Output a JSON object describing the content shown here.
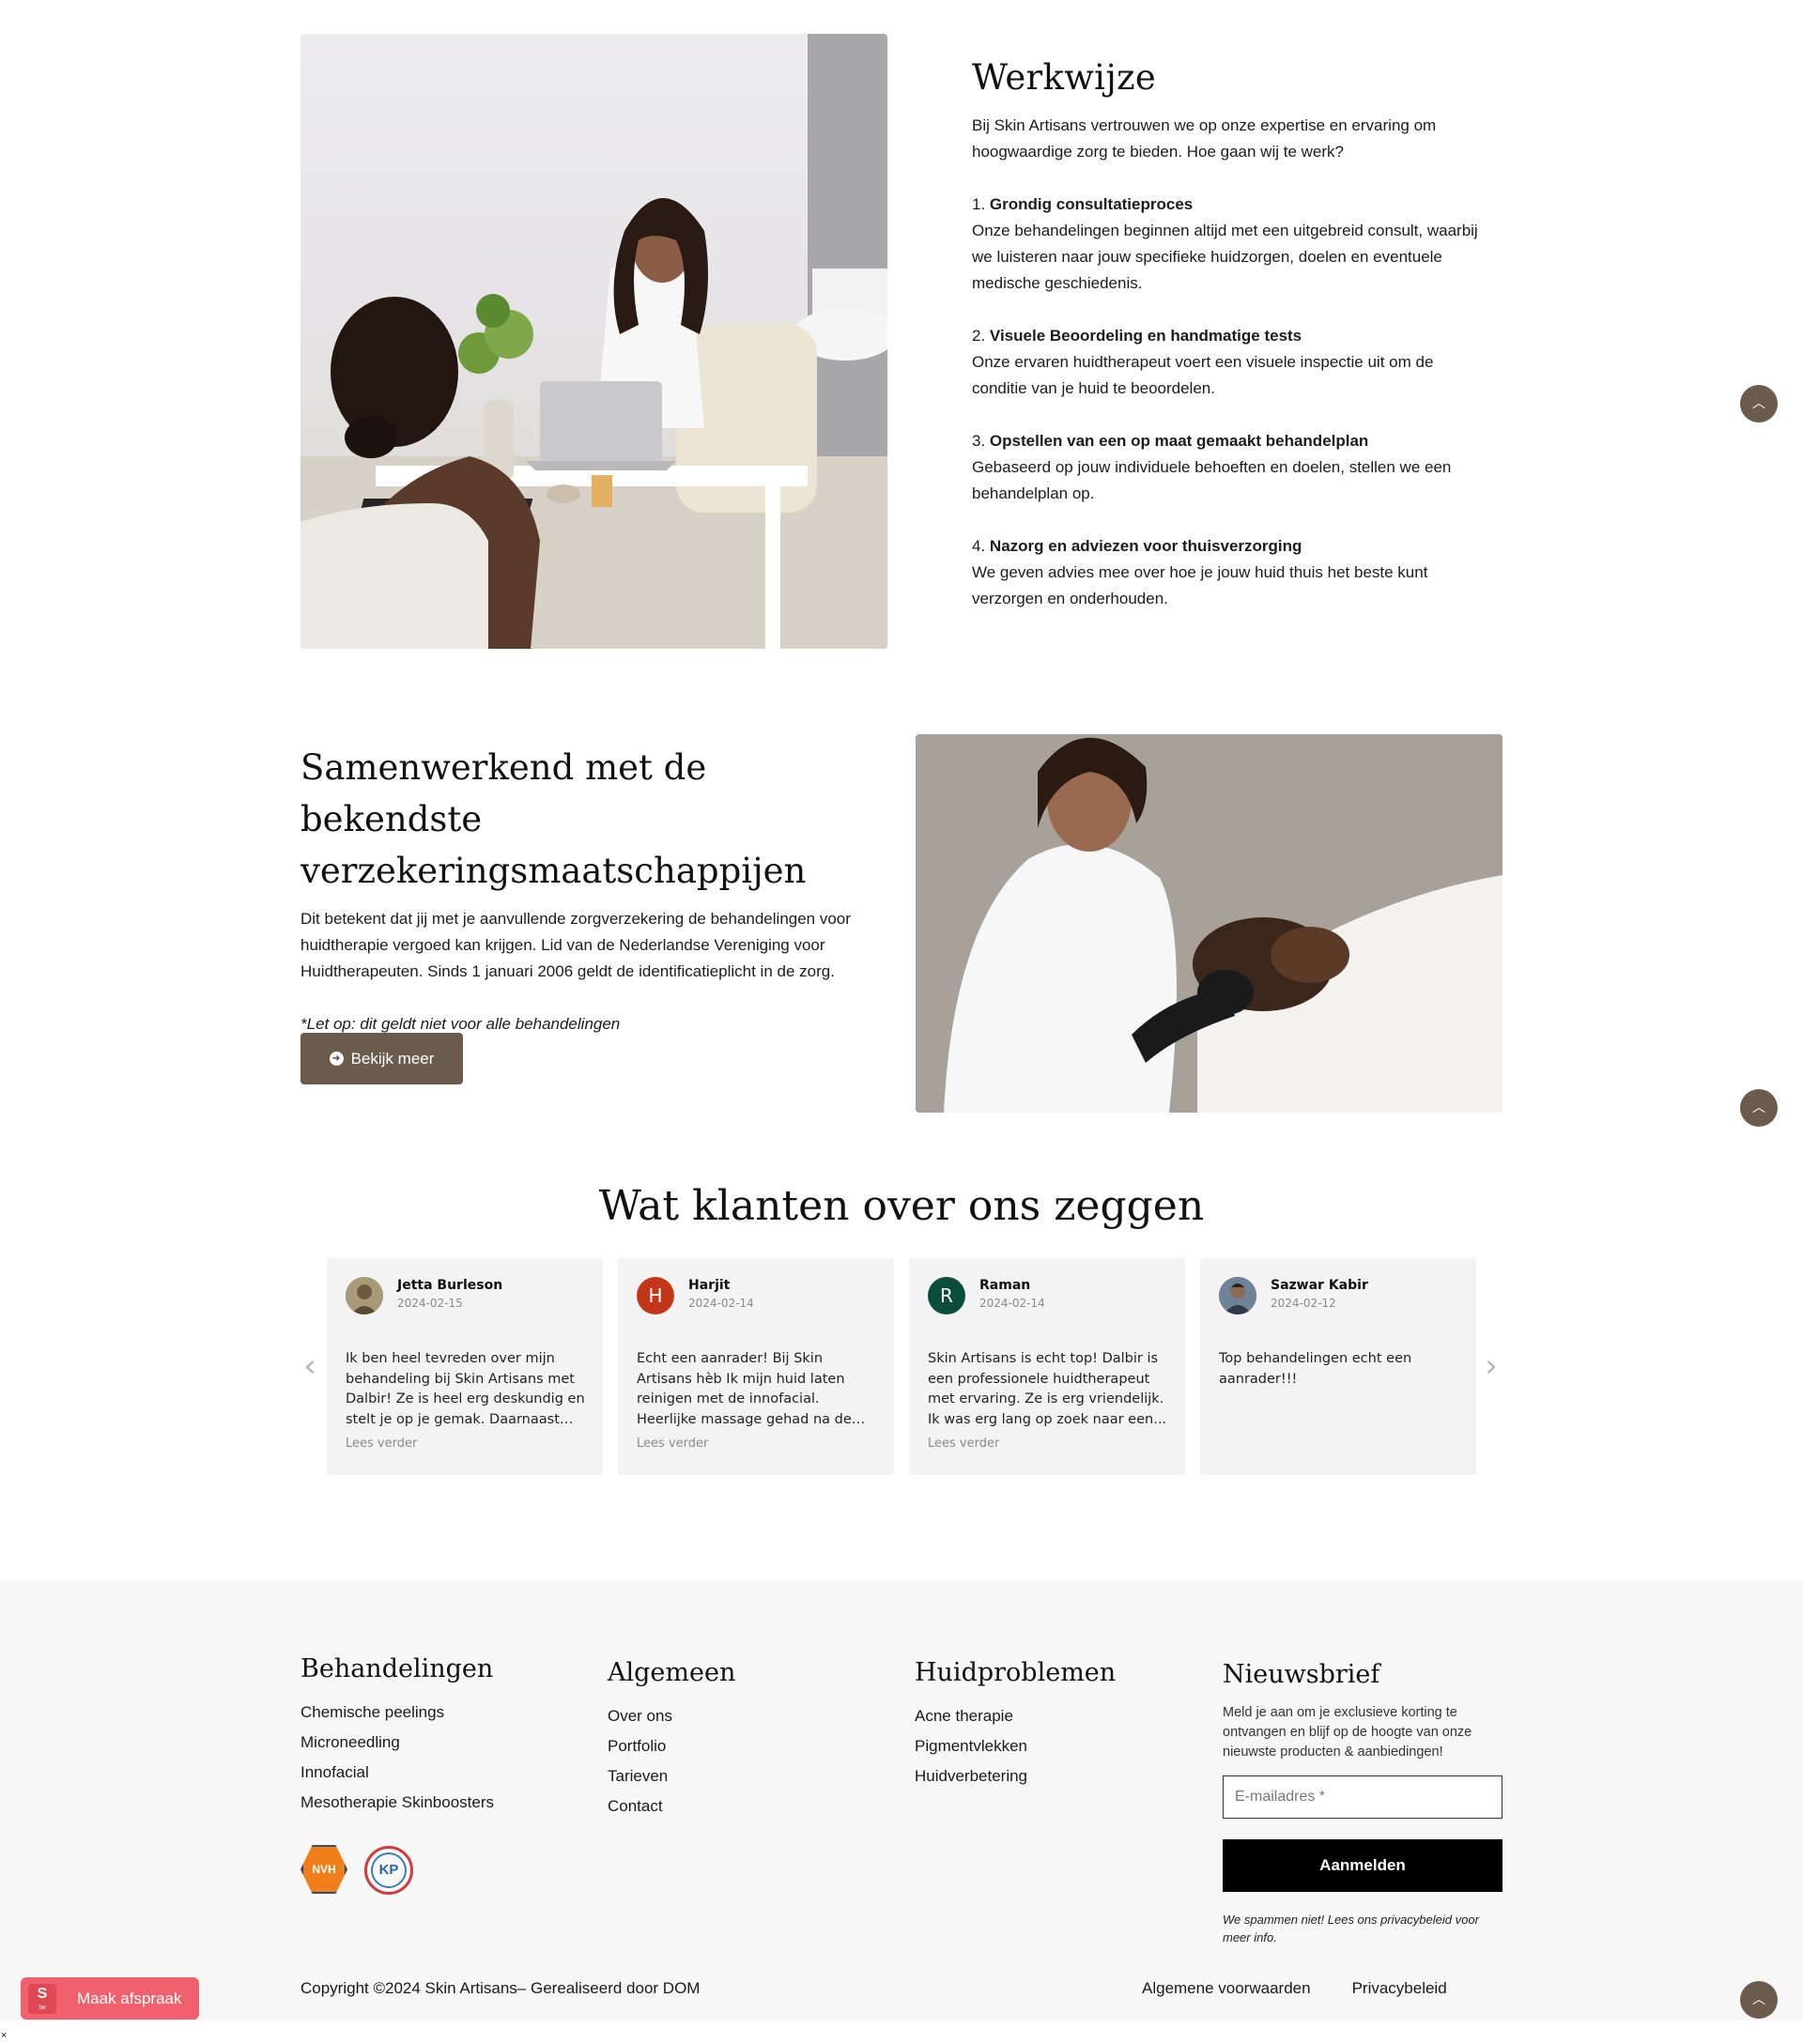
{
  "werkwijze": {
    "title": "Werkwijze",
    "intro": "Bij Skin Artisans vertrouwen we op onze expertise en ervaring om hoogwaardige zorg te bieden. Hoe gaan wij te werk?",
    "steps": [
      {
        "num": "1.",
        "title": "Grondig consultatieproces",
        "text": "Onze behandelingen beginnen altijd met een uitgebreid consult, waarbij we luisteren naar jouw specifieke huidzorgen, doelen en eventuele medische geschiedenis."
      },
      {
        "num": "2.",
        "title": "Visuele Beoordeling en handmatige tests",
        "text": "Onze ervaren huidtherapeut voert een visuele inspectie uit om de conditie van je huid te beoordelen."
      },
      {
        "num": "3.",
        "title": "Opstellen van een op maat gemaakt behandelplan",
        "text": "Gebaseerd op jouw individuele behoeften en doelen, stellen we een behandelplan op."
      },
      {
        "num": "4.",
        "title": "Nazorg en adviezen voor thuisverzorging",
        "text": "We geven advies mee over hoe je jouw huid thuis het beste kunt verzorgen en onderhouden."
      }
    ]
  },
  "samenwerkend": {
    "title": "Samenwerkend met de bekendste verzekeringsmaatschappijen",
    "text": "Dit betekent dat jij met je aanvullende zorgverzekering de behandelingen voor huidtherapie vergoed kan krijgen. Lid van de Nederlandse Vereniging voor Huidtherapeuten. Sinds 1 januari 2006 geldt de identificatieplicht in de zorg.",
    "note": "*Let op: dit geldt niet voor alle behandelingen",
    "button_label": "Bekijk meer"
  },
  "reviews": {
    "title": "Wat klanten over ons zeggen",
    "read_more": "Lees verder",
    "items": [
      {
        "name": "Jetta Burleson",
        "date": "2024-02-15",
        "initial": "",
        "avatar_color": "#8a7d62",
        "text": "Ik ben heel tevreden over mijn behandeling bij Skin Artisans met Dalbir! Ze is heel erg deskundig en stelt je op je gemak. Daarnaast be...",
        "has_more": true
      },
      {
        "name": "Harjit",
        "date": "2024-02-14",
        "initial": "H",
        "avatar_color": "#c2361a",
        "text": "Echt een aanrader! Bij Skin Artisans hèb Ik mijn huid laten reinigen met de innofacial. Heerlijke massage gehad na de behandeling. Niet...",
        "has_more": true
      },
      {
        "name": "Raman",
        "date": "2024-02-14",
        "initial": "R",
        "avatar_color": "#0b4d3b",
        "text": "Skin Artisans is echt top! Dalbir is een professionele huidtherapeut met ervaring. Ze is erg vriendelijk. Ik was erg lang op zoek naar een...",
        "has_more": true
      },
      {
        "name": "Sazwar Kabir",
        "date": "2024-02-12",
        "initial": "",
        "avatar_color": "#5a6e80",
        "text": "Top behandelingen echt een aanrader!!!",
        "has_more": false
      }
    ]
  },
  "footer": {
    "behandelingen": {
      "title": "Behandelingen",
      "items": [
        "Chemische peelings",
        "Microneedling",
        "Innofacial",
        "Mesotherapie Skinboosters"
      ]
    },
    "algemeen": {
      "title": "Algemeen",
      "items": [
        "Over ons",
        "Portfolio",
        "Tarieven",
        "Contact"
      ]
    },
    "huidproblemen": {
      "title": "Huidproblemen",
      "items": [
        "Acne therapie",
        "Pigmentvlekken",
        "Huidverbetering"
      ]
    },
    "badges": {
      "nvh": "NVH",
      "kp": "KP"
    },
    "newsletter": {
      "title": "Nieuwsbrief",
      "description": "Meld je aan om je exclusieve korting te ontvangen en blijf op de hoogte van onze nieuwste producten & aanbiedingen!",
      "email_placeholder": "E-mailadres *",
      "button_label": "Aanmelden",
      "note": "We spammen niet! Lees ons privacybeleid voor meer info."
    },
    "copyright": "Copyright ©2024 Skin Artisans– Gerealiseerd door DOM",
    "legal_links": [
      "Algemene voorwaarden",
      "Privacybeleid"
    ]
  },
  "widgets": {
    "booking_label": "Maak afspraak",
    "booking_logo": "S",
    "booking_logo_sub": "tw",
    "scroll_top_icon": "chevron-up-icon",
    "close": "×"
  },
  "colors": {
    "accent_brown": "#6b5b4c",
    "booking_pink": "#f0616d",
    "footer_bg": "#f7f7f7",
    "card_bg": "#f3f3f3"
  }
}
